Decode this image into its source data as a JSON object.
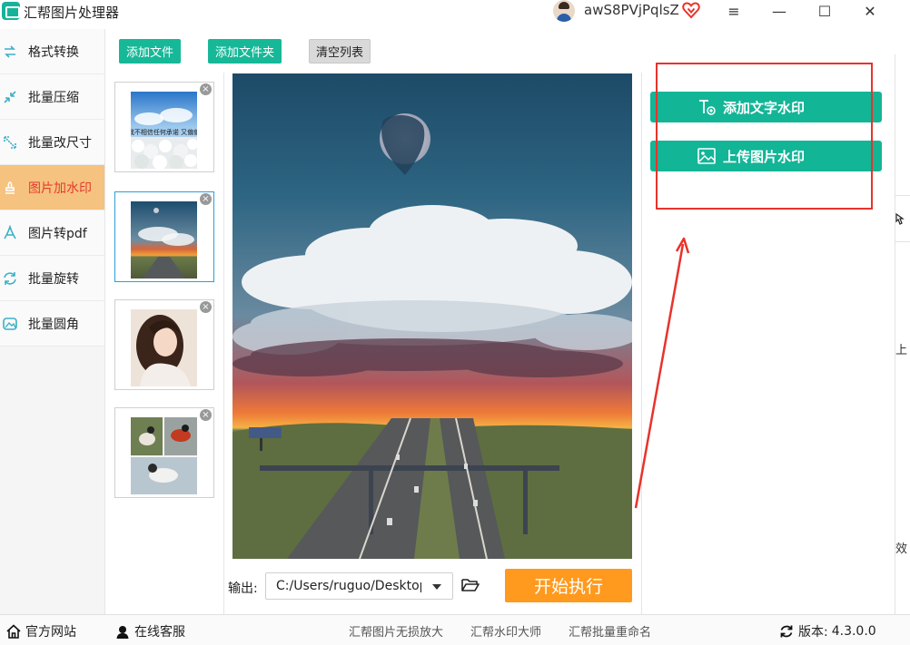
{
  "app": {
    "title": "汇帮图片处理器",
    "username": "awS8PVjPqlsZ"
  },
  "window": {
    "menu_icon": "≡",
    "minimize_icon": "—",
    "maximize_icon": "☐",
    "close_icon": "✕"
  },
  "sidebar": {
    "items": [
      {
        "label": "格式转换",
        "icon": "format-convert-icon",
        "active": false
      },
      {
        "label": "批量压缩",
        "icon": "compress-icon",
        "active": false
      },
      {
        "label": "批量改尺寸",
        "icon": "resize-icon",
        "active": false
      },
      {
        "label": "图片加水印",
        "icon": "watermark-icon",
        "active": true
      },
      {
        "label": "图片转pdf",
        "icon": "pdf-icon",
        "active": false
      },
      {
        "label": "批量旋转",
        "icon": "rotate-icon",
        "active": false
      },
      {
        "label": "批量圆角",
        "icon": "rounded-corner-icon",
        "active": false
      }
    ]
  },
  "toolbar": {
    "add_file": "添加文件",
    "add_folder": "添加文件夹",
    "clear_list": "清空列表"
  },
  "thumbnails": [
    {
      "name": "clouds-flowers-thumbnail",
      "caption": "我不相信任何承诺 又偏偏",
      "selected": false
    },
    {
      "name": "highway-sunset-thumbnail",
      "selected": true
    },
    {
      "name": "anime-girl-thumbnail",
      "selected": false
    },
    {
      "name": "birds-collage-thumbnail",
      "selected": false
    }
  ],
  "output": {
    "label": "输出:",
    "path": "C:/Users/ruguo/Desktop"
  },
  "start_button": "开始执行",
  "watermark": {
    "add_text": "添加文字水印",
    "upload_image": "上传图片水印"
  },
  "background_window": {
    "text_1": "上",
    "text_2": "效"
  },
  "statusbar": {
    "official_site": "官方网站",
    "online_service": "在线客服",
    "links": [
      "汇帮图片无损放大",
      "汇帮水印大师",
      "汇帮批量重命名"
    ],
    "version_label": "版本:",
    "version": "4.3.0.0"
  },
  "colors": {
    "accent": "#17b898",
    "active_tab": "#f6c27f",
    "start": "#ff9a1e",
    "highlight": "#e8332b"
  }
}
